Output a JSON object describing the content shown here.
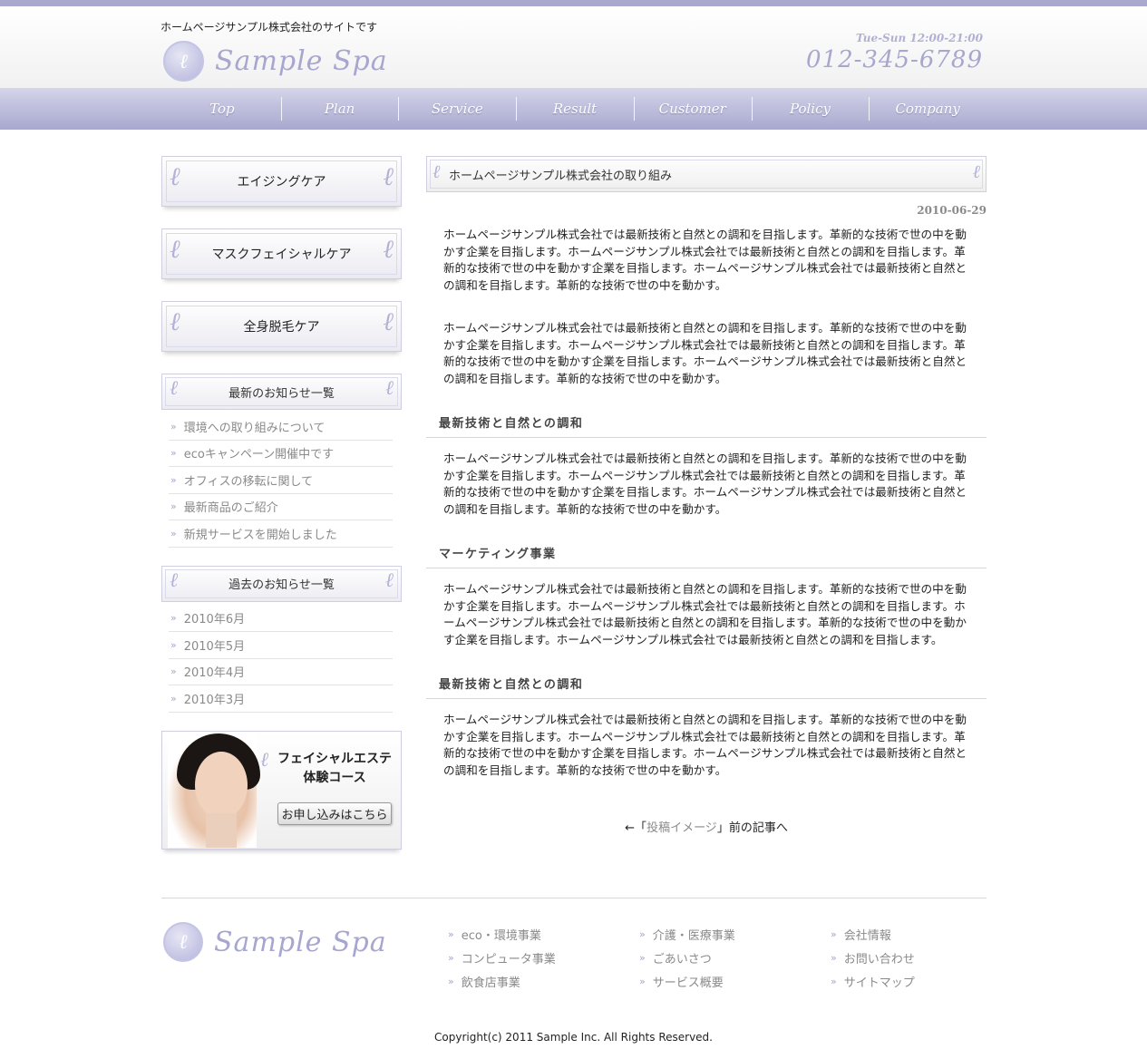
{
  "header": {
    "tagline": "ホームページサンプル株式会社のサイトです",
    "logo_text": "Sample Spa",
    "hours": "Tue-Sun 12:00-21:00",
    "phone": "012-345-6789"
  },
  "nav": [
    "Top",
    "Plan",
    "Service",
    "Result",
    "Customer",
    "Policy",
    "Company"
  ],
  "sidebar": {
    "buttons": [
      "エイジングケア",
      "マスクフェイシャルケア",
      "全身脱毛ケア"
    ],
    "latest_heading": "最新のお知らせ一覧",
    "latest": [
      "環境への取り組みについて",
      "ecoキャンペーン開催中です",
      "オフィスの移転に関して",
      "最新商品のご紹介",
      "新規サービスを開始しました"
    ],
    "past_heading": "過去のお知らせ一覧",
    "past": [
      "2010年6月",
      "2010年5月",
      "2010年4月",
      "2010年3月"
    ],
    "banner": {
      "title_line1": "フェイシャルエステ",
      "title_line2": "体験コース",
      "button": "お申し込みはこちら"
    }
  },
  "main": {
    "heading": "ホームページサンプル株式会社の取り組み",
    "date": "2010-06-29",
    "p1": "ホームページサンプル株式会社では最新技術と自然との調和を目指します。革新的な技術で世の中を動かす企業を目指します。ホームページサンプル株式会社では最新技術と自然との調和を目指します。革新的な技術で世の中を動かす企業を目指します。ホームページサンプル株式会社では最新技術と自然との調和を目指します。革新的な技術で世の中を動かす。",
    "p2": "ホームページサンプル株式会社では最新技術と自然との調和を目指します。革新的な技術で世の中を動かす企業を目指します。ホームページサンプル株式会社では最新技術と自然との調和を目指します。革新的な技術で世の中を動かす企業を目指します。ホームページサンプル株式会社では最新技術と自然との調和を目指します。革新的な技術で世の中を動かす。",
    "sec1_title": "最新技術と自然との調和",
    "sec1_text": "ホームページサンプル株式会社では最新技術と自然との調和を目指します。革新的な技術で世の中を動かす企業を目指します。ホームページサンプル株式会社では最新技術と自然との調和を目指します。革新的な技術で世の中を動かす企業を目指します。ホームページサンプル株式会社では最新技術と自然との調和を目指します。革新的な技術で世の中を動かす。",
    "sec2_title": "マーケティング事業",
    "sec2_text": "ホームページサンプル株式会社では最新技術と自然との調和を目指します。革新的な技術で世の中を動かす企業を目指します。ホームページサンプル株式会社では最新技術と自然との調和を目指します。ホームページサンプル株式会社では最新技術と自然との調和を目指します。革新的な技術で世の中を動かす企業を目指します。ホームページサンプル株式会社では最新技術と自然との調和を目指します。",
    "sec3_title": "最新技術と自然との調和",
    "sec3_text": "ホームページサンプル株式会社では最新技術と自然との調和を目指します。革新的な技術で世の中を動かす企業を目指します。ホームページサンプル株式会社では最新技術と自然との調和を目指します。革新的な技術で世の中を動かす企業を目指します。ホームページサンプル株式会社では最新技術と自然との調和を目指します。革新的な技術で世の中を動かす。",
    "prev_arrow": "←「",
    "prev_link": "投稿イメージ",
    "prev_suffix": "」前の記事へ"
  },
  "footer": {
    "logo_text": "Sample Spa",
    "col1": [
      "eco・環境事業",
      "コンピュータ事業",
      "飲食店事業"
    ],
    "col2": [
      "介護・医療事業",
      "ごあいさつ",
      "サービス概要"
    ],
    "col3": [
      "会社情報",
      "お問い合わせ",
      "サイトマップ"
    ],
    "copyright": "Copyright(c) 2011 Sample Inc. All Rights Reserved."
  },
  "icons": {
    "chevron": "»",
    "ornament": "ℓ"
  },
  "colors": {
    "accent": "#a8a8cf",
    "link_gray": "#8a8a8a"
  }
}
